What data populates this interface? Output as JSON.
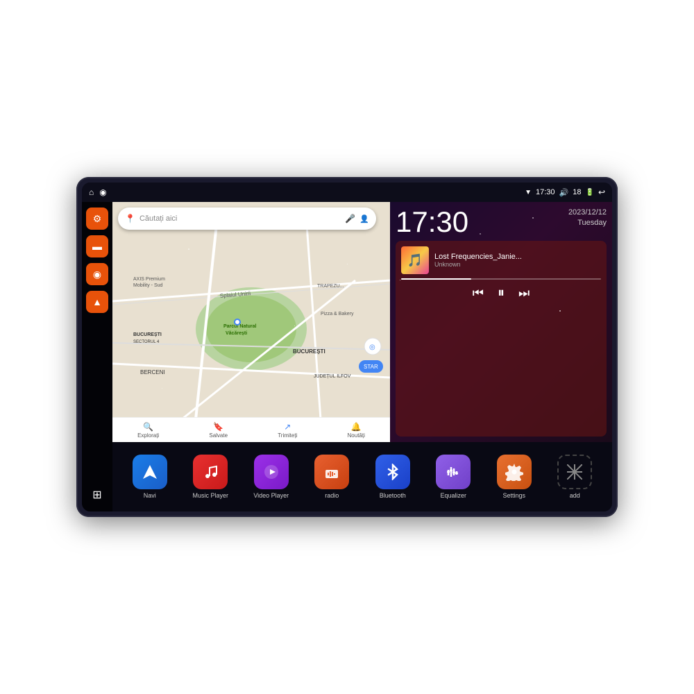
{
  "device": {
    "status_bar": {
      "time": "17:30",
      "battery": "18",
      "wifi_icon": "▼",
      "volume_icon": "🔊",
      "back_icon": "↩"
    },
    "sidebar": {
      "buttons": [
        {
          "id": "settings",
          "icon": "⚙",
          "color": "orange",
          "label": "Settings"
        },
        {
          "id": "files",
          "icon": "▬",
          "color": "orange",
          "label": "Files"
        },
        {
          "id": "maps",
          "icon": "◉",
          "color": "orange",
          "label": "Maps"
        },
        {
          "id": "navigation",
          "icon": "▲",
          "color": "orange",
          "label": "Navigation"
        },
        {
          "id": "apps",
          "icon": "⋮⋮⋮",
          "color": "grid",
          "label": "Apps"
        }
      ]
    },
    "map": {
      "search_placeholder": "Căutați aici",
      "locations": [
        "AXIS Premium Mobility - Sud",
        "Parcul Natural Văcărești",
        "Pizza & Bakery",
        "BUCUREȘTI",
        "BUCUREȘTI SECTORUL 4",
        "JUDEȚUL ILFOV",
        "BERCENI"
      ],
      "nav_items": [
        {
          "icon": "🔍",
          "label": "Explorați"
        },
        {
          "icon": "🔖",
          "label": "Salvate"
        },
        {
          "icon": "↗",
          "label": "Trimiteți"
        },
        {
          "icon": "🔔",
          "label": "Noutăți"
        }
      ]
    },
    "clock": {
      "time": "17:30",
      "date": "2023/12/12",
      "day": "Tuesday"
    },
    "music": {
      "track_name": "Lost Frequencies_Janie...",
      "artist": "Unknown",
      "progress": 35
    },
    "apps": [
      {
        "id": "navi",
        "label": "Navi",
        "icon": "▲",
        "style": "navi"
      },
      {
        "id": "music-player",
        "label": "Music Player",
        "icon": "♪",
        "style": "music"
      },
      {
        "id": "video-player",
        "label": "Video Player",
        "icon": "▶",
        "style": "video"
      },
      {
        "id": "radio",
        "label": "radio",
        "icon": "📻",
        "style": "radio"
      },
      {
        "id": "bluetooth",
        "label": "Bluetooth",
        "icon": "⚡",
        "style": "bluetooth"
      },
      {
        "id": "equalizer",
        "label": "Equalizer",
        "icon": "≡",
        "style": "equalizer"
      },
      {
        "id": "settings",
        "label": "Settings",
        "icon": "⚙",
        "style": "settings"
      },
      {
        "id": "add",
        "label": "add",
        "icon": "+",
        "style": "add"
      }
    ]
  }
}
